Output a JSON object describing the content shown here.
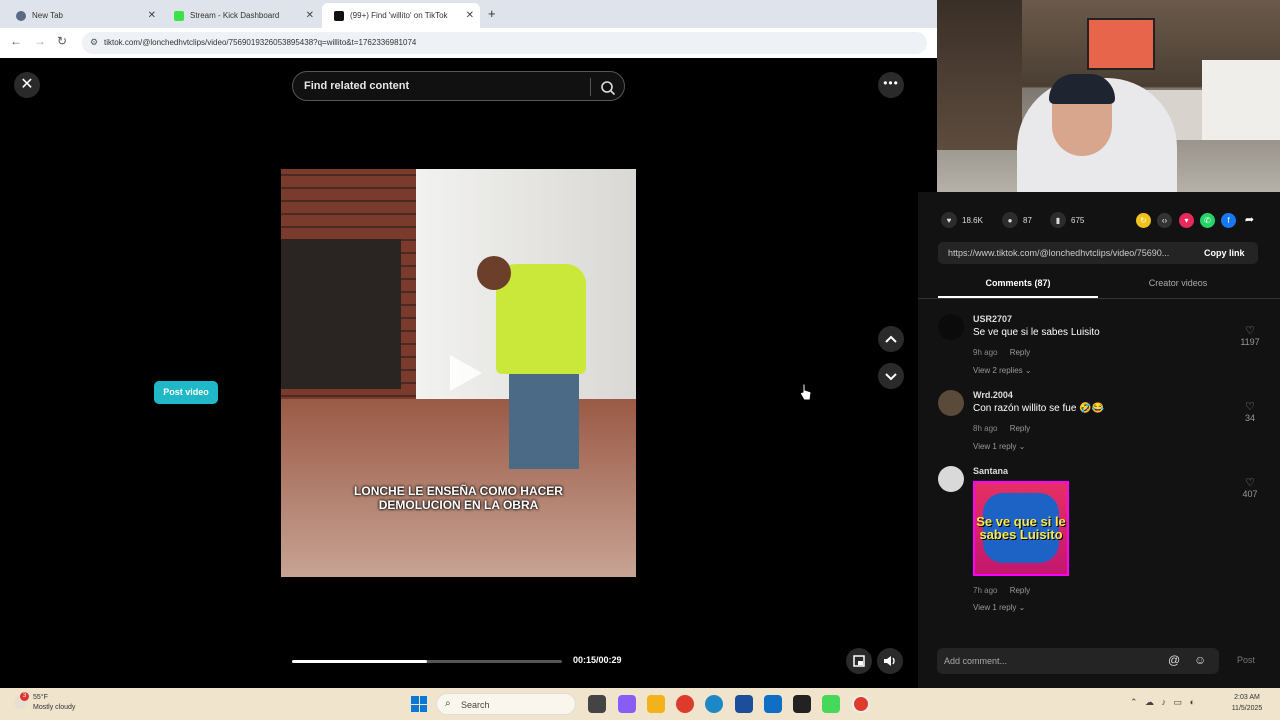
{
  "browser": {
    "tabs": [
      {
        "title": "New Tab",
        "active": false
      },
      {
        "title": "Stream - Kick Dashboard",
        "active": false
      },
      {
        "title": "(99+) Find 'willito' on TikTok",
        "active": true
      }
    ],
    "url": "tiktok.com/@lonchedhvtclips/video/7569019326053895438?q=willito&t=1762336981074"
  },
  "video": {
    "search_placeholder": "Find related content",
    "post_video_label": "Post video",
    "caption": "LONCHE LE ENSEÑA COMO HACER\nDEMOLUCION EN LA OBRA",
    "time": "00:15/00:29",
    "progress": 0.5
  },
  "panel": {
    "stats": {
      "likes": "18.6K",
      "comments": "87",
      "saves": "675"
    },
    "share_icons": [
      "repost-icon",
      "embed-icon",
      "send-icon",
      "whatsapp-icon",
      "facebook-icon",
      "share-arrow-icon"
    ],
    "link": "https://www.tiktok.com/@lonchedhvtclips/video/75690...",
    "copy_label": "Copy link",
    "tabs": {
      "comments": "Comments (87)",
      "creator": "Creator videos"
    },
    "comments": [
      {
        "user": "USR2707",
        "text": "Se ve que si le sabes Luisito",
        "time": "9h ago",
        "reply": "Reply",
        "replies": "View 2 replies",
        "likes": "1197"
      },
      {
        "user": "Wrd.2004",
        "text": "Con razón willito se fue 🤣😂",
        "time": "8h ago",
        "reply": "Reply",
        "replies": "View 1 reply",
        "likes": "34"
      },
      {
        "user": "Santana",
        "sticker_text": "Se ve que si le sabes Luisito",
        "time": "7h ago",
        "reply": "Reply",
        "replies": "View 1 reply",
        "likes": "407"
      }
    ],
    "add_comment_placeholder": "Add comment...",
    "post_label": "Post"
  },
  "taskbar": {
    "weather_temp": "55°F",
    "weather_desc": "Mostly cloudy",
    "weather_badge": "3",
    "search_label": "Search",
    "time": "2:03 AM",
    "date": "11/5/2025"
  },
  "colors": {
    "accent_teal": "#20b8c8",
    "background": "#000000",
    "panel": "#121212",
    "taskbar": "#f0e4cc"
  }
}
